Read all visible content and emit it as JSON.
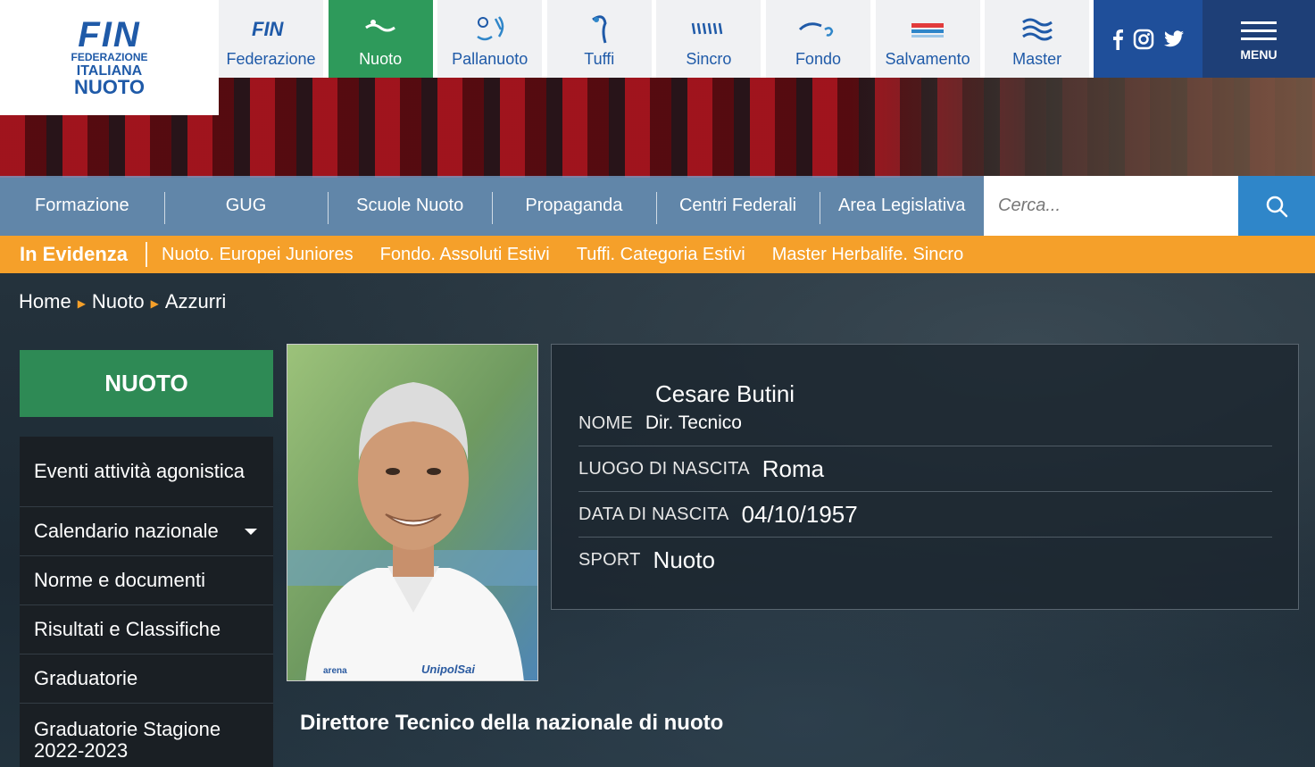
{
  "logo": {
    "brand": "FIN",
    "line1": "FEDERAZIONE",
    "line2": "ITALIANA",
    "line3": "NUOTO"
  },
  "sport_tabs": [
    {
      "label": "Federazione",
      "icon": "fin-icon"
    },
    {
      "label": "Nuoto",
      "icon": "swimmer-icon",
      "active": true
    },
    {
      "label": "Pallanuoto",
      "icon": "water-polo-icon"
    },
    {
      "label": "Tuffi",
      "icon": "diving-icon"
    },
    {
      "label": "Sincro",
      "icon": "synchro-icon"
    },
    {
      "label": "Fondo",
      "icon": "open-water-icon"
    },
    {
      "label": "Salvamento",
      "icon": "lifesaving-icon"
    },
    {
      "label": "Master",
      "icon": "master-waves-icon"
    }
  ],
  "social": [
    "facebook-icon",
    "instagram-icon",
    "twitter-icon"
  ],
  "menu": {
    "label": "MENU"
  },
  "subnav": [
    "Formazione",
    "GUG",
    "Scuole Nuoto",
    "Propaganda",
    "Centri Federali",
    "Area Legislativa"
  ],
  "search": {
    "placeholder": "Cerca..."
  },
  "evidenza": {
    "title": "In Evidenza",
    "items": [
      "Nuoto. Europei Juniores",
      "Fondo. Assoluti Estivi",
      "Tuffi. Categoria Estivi",
      "Master Herbalife. Sincro"
    ]
  },
  "breadcrumb": [
    "Home",
    "Nuoto",
    "Azzurri"
  ],
  "sidebar": {
    "title": "NUOTO",
    "items": [
      {
        "label": "Eventi attività agonistica"
      },
      {
        "label": "Calendario nazionale",
        "has_dropdown": true
      },
      {
        "label": "Norme e documenti"
      },
      {
        "label": "Risultati e Classifiche"
      },
      {
        "label": "Graduatorie"
      },
      {
        "label": "Graduatorie Stagione 2022-2023"
      }
    ]
  },
  "profile": {
    "name": "Cesare Butini",
    "nome_label": "NOME",
    "role": "Dir. Tecnico",
    "luogo_label": "LUOGO DI NASCITA",
    "luogo": "Roma",
    "data_label": "DATA DI NASCITA",
    "data": "04/10/1957",
    "sport_label": "SPORT",
    "sport": "Nuoto",
    "caption": "Direttore Tecnico della nazionale di nuoto"
  },
  "colors": {
    "brand_blue": "#1f5aa8",
    "active_green": "#2e9a5b",
    "evidenza_orange": "#f5a02a",
    "search_blue": "#2f86c9"
  }
}
